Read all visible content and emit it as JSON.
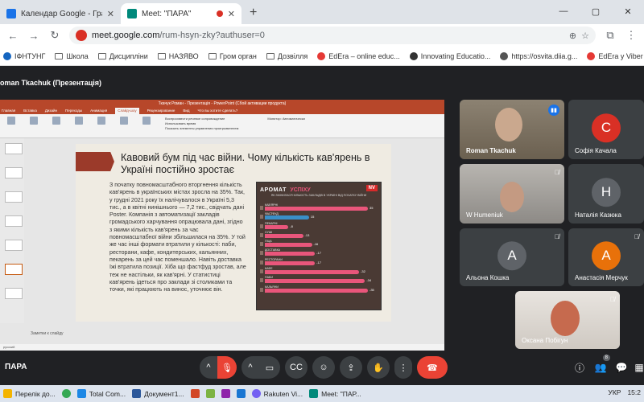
{
  "browser": {
    "tabs": [
      {
        "title": "Календар Google - Графік поч",
        "icon_color": "#1a73e8",
        "active": false
      },
      {
        "title": "Meet: \"ПАРА\"",
        "icon_color": "#00897b",
        "active": true
      }
    ],
    "new_tab": "+",
    "window_controls": {
      "minimize": "—",
      "maximize": "▢",
      "close": "✕"
    },
    "url_host": "meet.google.com",
    "url_path": "/rum-hsyn-zky?authuser=0",
    "bookmarks": [
      "ІФНТУНГ",
      "Школа",
      "Дисципліни",
      "НАЗЯВО",
      "Гром орган",
      "Дозвілля",
      "EdEra – online educ...",
      "Innovating Educatio...",
      "https://osvita.diia.g...",
      "EdEra у Viber"
    ]
  },
  "meet": {
    "presenter_label": "oman Tkachuk (Презентація)",
    "meeting_name": "ПАРА",
    "participants": [
      {
        "name": "Roman Tkachuk",
        "type": "video"
      },
      {
        "name": "Софія Качала",
        "initial": "C",
        "color": "#d93025"
      },
      {
        "name": "W Humeniuk",
        "type": "video"
      },
      {
        "name": "Наталія Казюка",
        "initial": "H",
        "color": "#5f6368"
      },
      {
        "name": "Альона Кошка",
        "initial": "A",
        "color": "#5f6368"
      },
      {
        "name": "Анастасія Мерчук",
        "initial": "A",
        "color": "#e8710a"
      },
      {
        "name": "Оксана Побігун",
        "type": "video"
      }
    ],
    "participant_count": "8"
  },
  "powerpoint": {
    "title": "Ткачук Роман - Презентація - PowerPoint (Сбой активации продукта)",
    "menu": [
      "Главная",
      "Вставка",
      "Дизайн",
      "Переходы",
      "Анимация",
      "Слайд-шоу",
      "Рецензирование",
      "Вид",
      "Что вы хотите сделать?"
    ],
    "menu_selected": "Слайд-шоу",
    "ribbon_checks": [
      "Воспроизвести речевое сопровождение",
      "Использовать время",
      "Показать элементы управления проигрывателем"
    ],
    "monitor_label": "Монитор: Автоматически",
    "notes_label": "Заметки к слайду",
    "status": "русский"
  },
  "slide": {
    "title": "Кавовий бум під час війни. Чому кількість кав'ярень в Україні постійно зростає",
    "body": "З початку повномасштабного вторгнення кількість кав'ярень в українських містах зросла на 35%. Так, у грудні 2021 року їх налічувалося в Україні 5,3 тис., а в квітні нинішнього — 7,2 тис., свідчать дані Poster. Компанія з автоматизації закладів громадського харчування опрацювала дані, згідно з якими кількість кав'ярень за час повномасштабної війни збільшилася на 35%. У той же час інші формати втратили у кількості: паби, ресторани, кафе, кондитерських, кальянних, пекарень за цей час поменшало. Навіть доставка їжі втратила позиції. Хіба що фастфуд зростав, але теж не настільки, як кав'ярні. У статистиці кав'ярень ідеться про заклади зі столиками та точки, які працюють на винос, уточнює він."
  },
  "infographic": {
    "title_left": "АРОМАТ",
    "title_right": "УСПІХУ",
    "badge": "NV",
    "subtitle": "ЯК ЗМІНИЛАСЯ КІЛЬКІСТЬ ЗАКЛАДІВ В УКРАЇНІ ВІД ПОЧАТКУ ВІЙНИ",
    "rows": [
      {
        "label": "КАВ'ЯРНІ",
        "value": "35",
        "pct": 35
      },
      {
        "label": "ФАСТФУД",
        "value": "15",
        "pct": 15
      },
      {
        "label": "ПЕКАРНІ",
        "value": "-8",
        "pct": 8
      },
      {
        "label": "СУШІ",
        "value": "-13",
        "pct": 13
      },
      {
        "label": "ПІЦА",
        "value": "-16",
        "pct": 16
      },
      {
        "label": "ДОСТАВКА",
        "value": "-17",
        "pct": 17
      },
      {
        "label": "РЕСТОРАНИ",
        "value": "-17",
        "pct": 17
      },
      {
        "label": "КАФЕ",
        "value": "-32",
        "pct": 32
      },
      {
        "label": "ПАБИ",
        "value": "-34",
        "pct": 34
      },
      {
        "label": "КАЛЬЯНИ",
        "value": "-35",
        "pct": 35
      }
    ]
  },
  "taskbar": {
    "items": [
      "Перелік до...",
      "Total Com...",
      "Документ1...",
      "Rakuten Vi...",
      "Meet: \"ПАР..."
    ],
    "lang": "УКР",
    "time": "15:2"
  }
}
